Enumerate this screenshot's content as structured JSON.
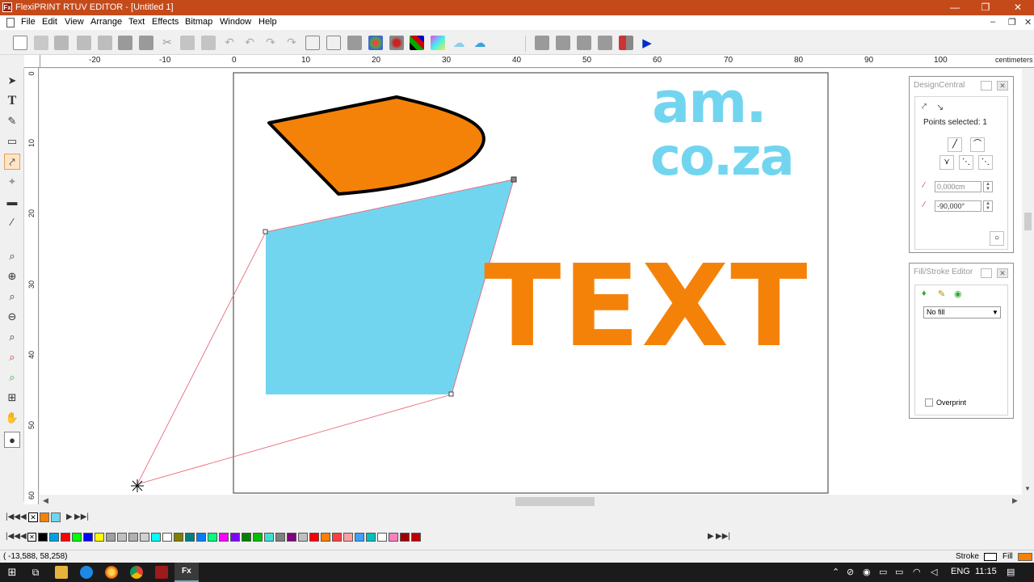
{
  "window": {
    "title": "FlexiPRINT RTUV EDITOR - [Untitled 1]",
    "app_badge": "Fx",
    "minimize": "—",
    "maximize": "❐",
    "close": "✕"
  },
  "menu": {
    "items": [
      "File",
      "Edit",
      "View",
      "Arrange",
      "Text",
      "Effects",
      "Bitmap",
      "Window",
      "Help"
    ],
    "mdi_min": "–",
    "mdi_restore": "❐",
    "mdi_close": "✕"
  },
  "ruler": {
    "units": "centimeters",
    "h_labels": [
      "-20",
      "-10",
      "0",
      "10",
      "20",
      "30",
      "40",
      "50",
      "60",
      "70",
      "80",
      "90",
      "100"
    ],
    "v_labels": [
      "0",
      "10",
      "20",
      "30",
      "40",
      "50",
      "60"
    ]
  },
  "canvas": {
    "logo_line1": "am.",
    "logo_line2": "co.za",
    "text_object": "TEXT",
    "colors": {
      "orange": "#f58208",
      "cyan": "#72d5f0"
    }
  },
  "design_central": {
    "title": "DesignCentral",
    "points_selected": "Points selected:  1",
    "distance": "0,000cm",
    "angle": "-90,000°"
  },
  "fill_stroke": {
    "title": "Fill/Stroke Editor",
    "fill_value": "No fill",
    "overprint_label": "Overprint"
  },
  "status": {
    "coords": "( -13,588,      58,258)",
    "stroke_label": "Stroke",
    "fill_label": "Fill"
  },
  "taskbar": {
    "app_label": "Fx",
    "lang": "ENG",
    "time": "11:15"
  },
  "palette": {
    "colors": [
      "#000000",
      "#00a0e0",
      "#ff0000",
      "#00ff00",
      "#0000ff",
      "#ffff00",
      "#a0a0a0",
      "#c0c0c0",
      "#b0b0b0",
      "#d0d0d0",
      "#00ffff",
      "#ffffff",
      "#808000",
      "#008080",
      "#0080ff",
      "#00ff80",
      "#ff00ff",
      "#8000ff",
      "#008000",
      "#00c000",
      "#40e0d0",
      "#808080",
      "#800080",
      "#c0c0c0",
      "#ff0000",
      "#ff8000",
      "#ff4040",
      "#ffa0a0",
      "#40a0ff",
      "#00c0c0",
      "#ffffff",
      "#ff80c0",
      "#a00000",
      "#c00000"
    ]
  }
}
